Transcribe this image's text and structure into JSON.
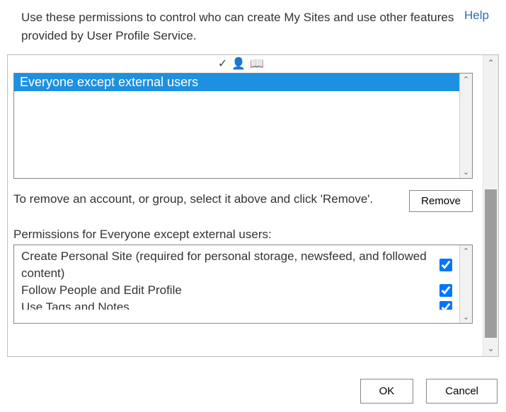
{
  "header": {
    "description": "Use these permissions to control who can create My Sites and use other features provided by User Profile Service.",
    "help_label": "Help"
  },
  "toolbar": {
    "checknames_icon": "checknames-icon",
    "browse_icon": "addressbook-icon"
  },
  "account_list": {
    "selected": "Everyone except external users"
  },
  "remove": {
    "instruction": "To remove an account, or group, select it above and click 'Remove'.",
    "button_label": "Remove"
  },
  "permissions": {
    "label": "Permissions for Everyone except external users:",
    "items": [
      {
        "label": "Create Personal Site (required for personal storage, newsfeed, and followed content)",
        "checked": true
      },
      {
        "label": "Follow People and Edit Profile",
        "checked": true
      },
      {
        "label": "Use Tags and Notes",
        "checked": true
      }
    ]
  },
  "buttons": {
    "ok": "OK",
    "cancel": "Cancel"
  }
}
